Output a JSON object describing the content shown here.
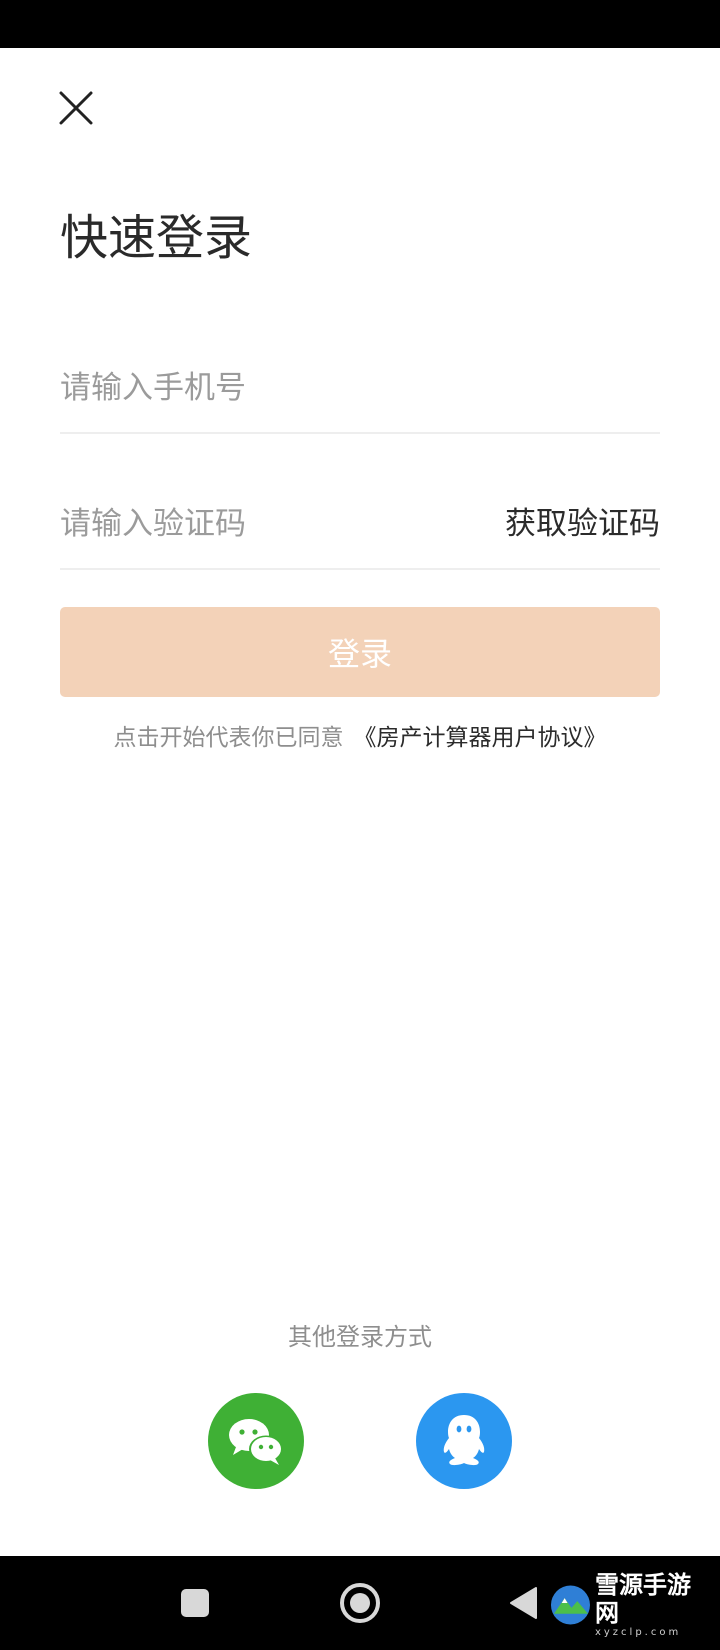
{
  "page": {
    "title": "快速登录"
  },
  "form": {
    "phone_placeholder": "请输入手机号",
    "code_placeholder": "请输入验证码",
    "get_code_label": "获取验证码",
    "login_label": "登录"
  },
  "agreement": {
    "text": "点击开始代表你已同意",
    "link": "《房产计算器用户协议》"
  },
  "other_login": {
    "label": "其他登录方式",
    "options": [
      {
        "icon": "wechat-icon",
        "color": "#3fb035"
      },
      {
        "icon": "qq-icon",
        "color": "#2b97f0"
      }
    ]
  },
  "colors": {
    "login_button": "#f3d2b8",
    "wechat": "#3fb035",
    "qq": "#2b97f0"
  },
  "watermark": {
    "name": "雪源手游网",
    "domain": "xyzclp.com"
  }
}
